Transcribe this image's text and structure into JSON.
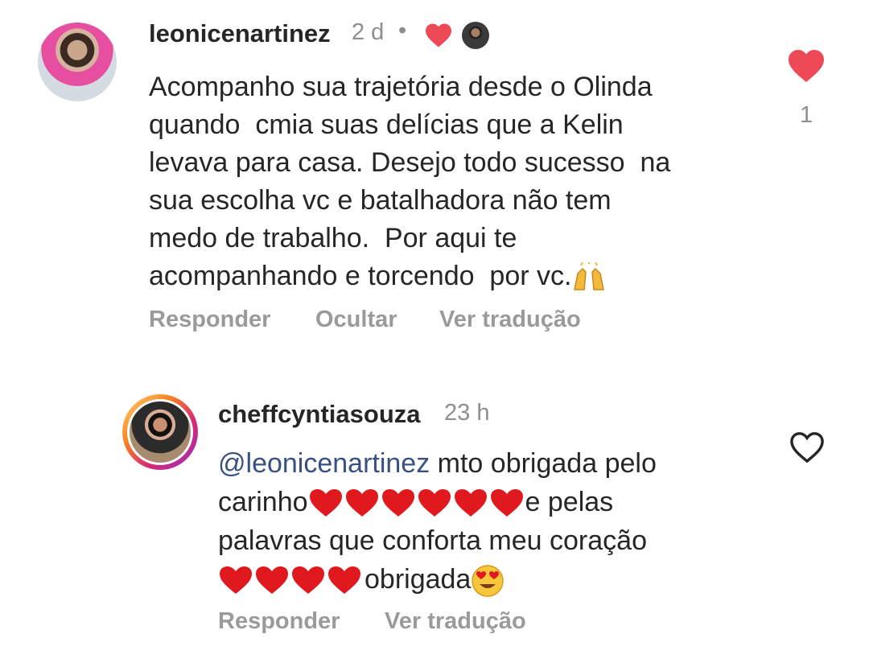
{
  "comment1": {
    "username": "leonicenartinez",
    "time": "2 d",
    "separator": "•",
    "lines": [
      "Acompanho sua trajetória desde o Olinda",
      "quando  cmia suas delícias que a Kelin",
      "levava para casa. Desejo todo sucesso  na",
      "sua escolha vc e batalhadora não tem",
      "medo de trabalho.  Por aqui te",
      "acompanhando e torcendo  por vc."
    ],
    "like_count": "1",
    "actions": {
      "reply": "Responder",
      "hide": "Ocultar",
      "translate": "Ver tradução"
    }
  },
  "comment2": {
    "username": "cheffcyntiasouza",
    "time": "23 h",
    "mention": "@leonicenartinez",
    "line1_rest": " mto obrigada pelo",
    "line2_start": "carinho",
    "line2_end": "e pelas",
    "line3": "palavras que conforta meu coração",
    "line4_end": "obrigada",
    "actions": {
      "reply": "Responder",
      "translate": "Ver tradução"
    }
  },
  "colors": {
    "heart_red": "#ed4956",
    "mention_blue": "#385185",
    "muted": "#8e8e8e"
  },
  "icons": [
    "heart-filled-icon",
    "heart-outline-icon",
    "praising-hands-emoji",
    "heart-emoji",
    "heart-eyes-emoji"
  ]
}
